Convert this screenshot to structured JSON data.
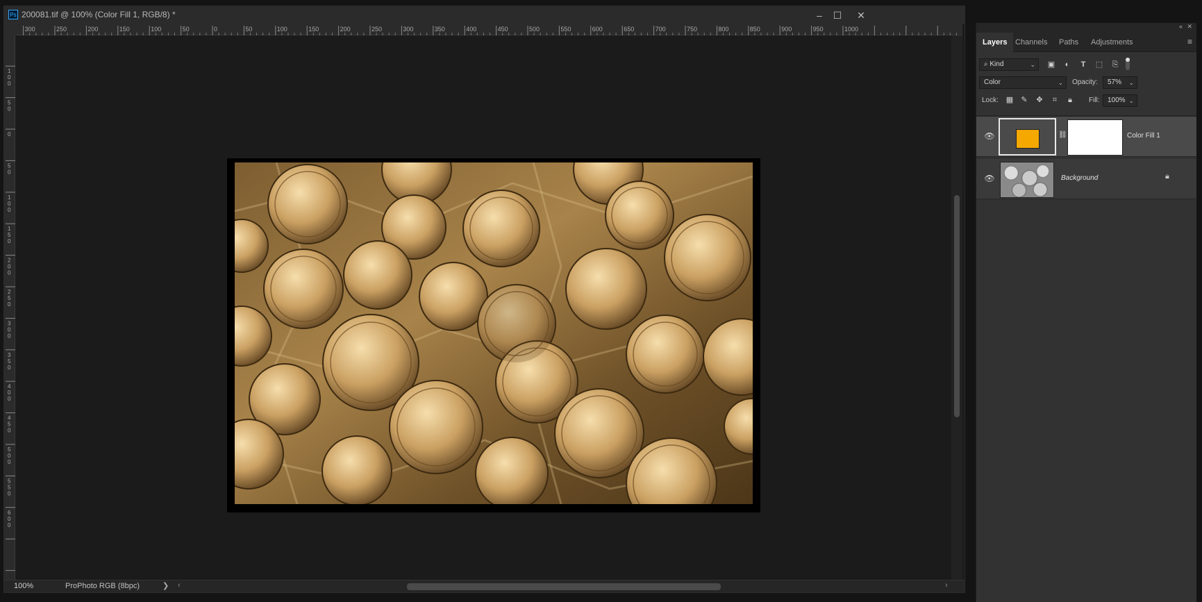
{
  "document": {
    "title": "200081.tif @ 100% (Color Fill 1, RGB/8) *",
    "app_logo": "Ps",
    "window_controls": {
      "minimize": "–",
      "maximize": "☐",
      "close": "✕"
    },
    "ruler_top_labels": [
      "0",
      "50",
      "100",
      "150",
      "200",
      "250",
      "300",
      "350",
      "400",
      "450",
      "500",
      "550",
      "600",
      "650",
      "700",
      "750",
      "800",
      "850",
      "900",
      "950",
      "1000"
    ],
    "ruler_left_labels": [
      "50",
      "100",
      "150",
      "200",
      "250",
      "300",
      "350",
      "400",
      "450",
      "500",
      "550",
      "600"
    ],
    "status": {
      "zoom": "100%",
      "profile": "ProPhoto RGB (8bpc)",
      "arrow": "❯"
    }
  },
  "layers_panel": {
    "tabs": [
      "Layers",
      "Channels",
      "Paths",
      "Adjustments"
    ],
    "active_tab": "Layers",
    "filter": {
      "label": "Kind"
    },
    "blend_mode": "Color",
    "opacity_label": "Opacity:",
    "opacity_value": "57%",
    "lock_label": "Lock:",
    "fill_label": "Fill:",
    "fill_value": "100%",
    "layers": [
      {
        "name": "Color Fill 1",
        "fill_color": "#f5a800",
        "selected": true,
        "visible": true
      },
      {
        "name": "Background",
        "locked": true,
        "visible": true
      }
    ]
  },
  "colors": {
    "accent": "#31a8ff",
    "fill_swatch": "#f5a800",
    "panel_bg": "#323232"
  }
}
